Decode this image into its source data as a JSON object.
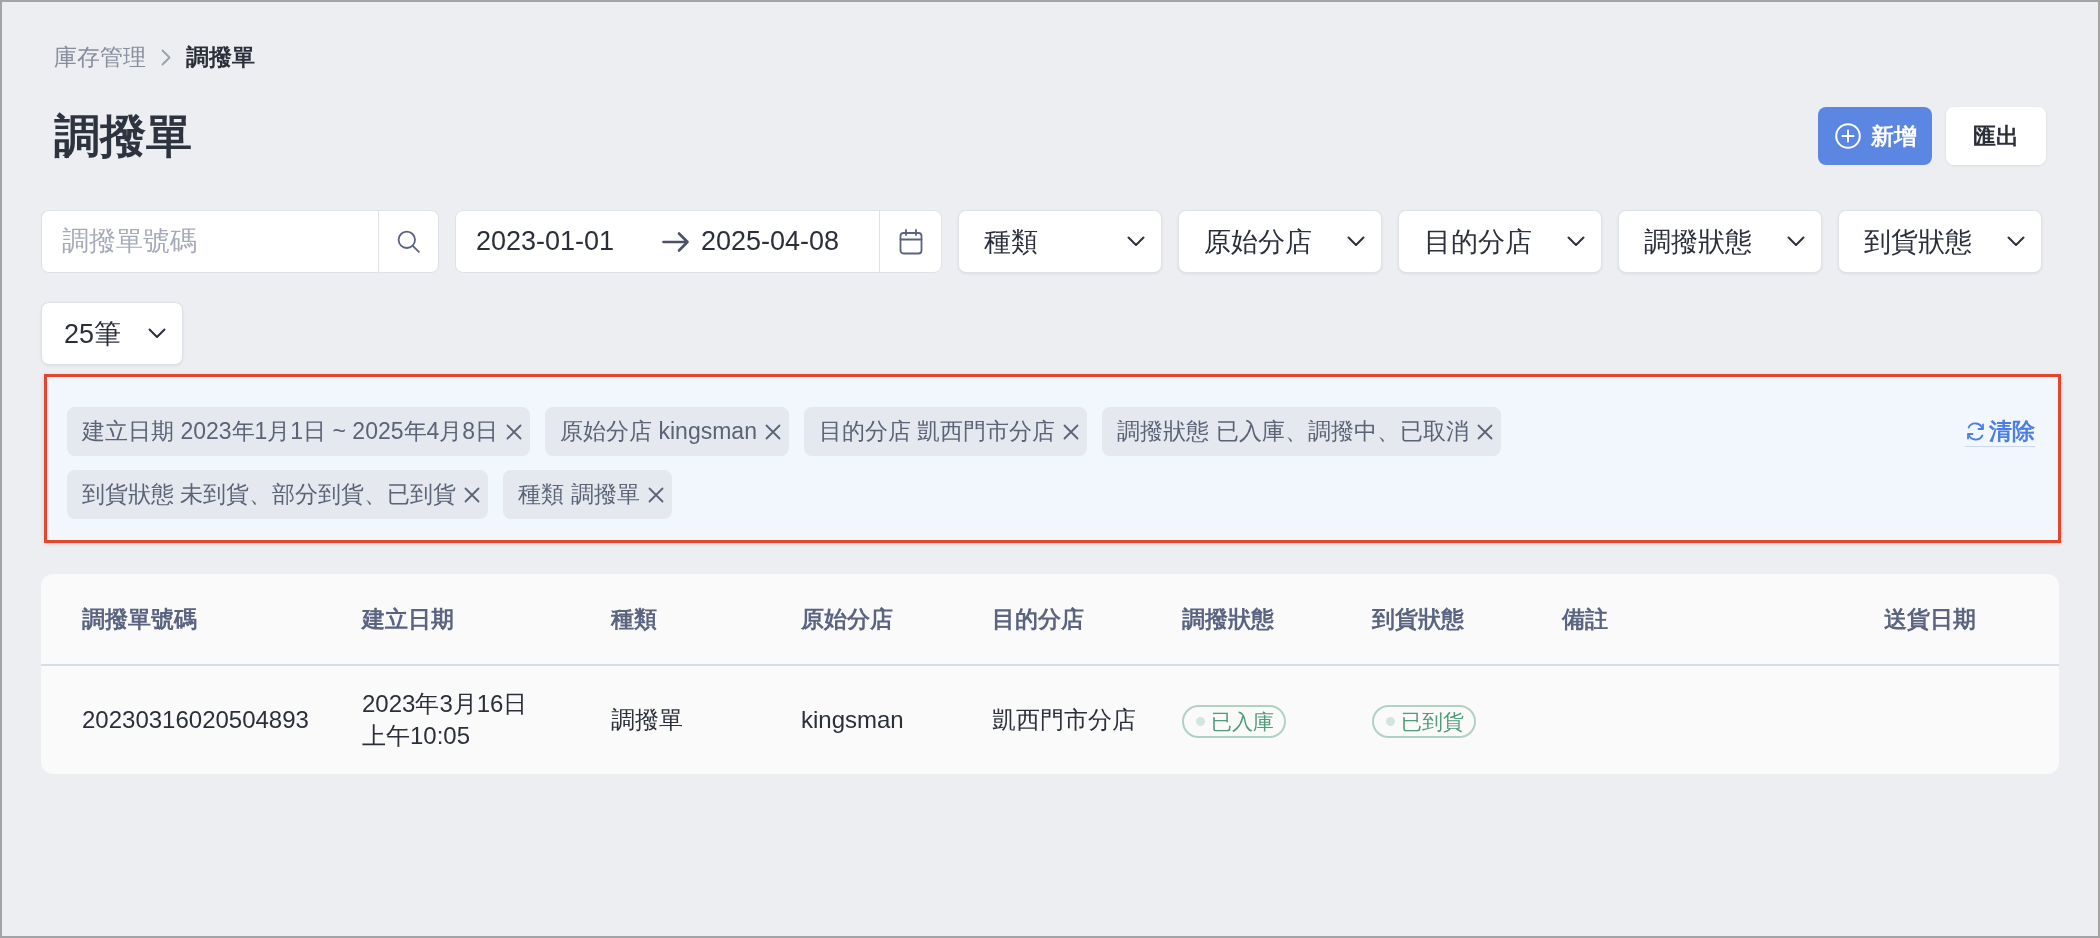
{
  "breadcrumb": [
    {
      "label": "庫存管理",
      "current": false
    },
    {
      "label": "調撥單",
      "current": true
    }
  ],
  "title": "調撥單",
  "actions": [
    {
      "kind": "primary",
      "label": "新增"
    },
    {
      "kind": "secondary",
      "label": "匯出"
    }
  ],
  "filters": {
    "search": {
      "placeholder": "調撥單號碼"
    },
    "date_range": {
      "start": "2023-01-01",
      "end": "2025-04-08"
    },
    "dropdowns": [
      {
        "label": "種類"
      },
      {
        "label": "原始分店"
      },
      {
        "label": "目的分店"
      },
      {
        "label": "調撥狀態"
      },
      {
        "label": "到貨狀態"
      }
    ],
    "page_size": {
      "label": "25筆"
    }
  },
  "active_filters": {
    "chips": [
      {
        "label": "建立日期 2023年1月1日 ~ 2025年4月8日"
      },
      {
        "label": "原始分店 kingsman"
      },
      {
        "label": "目的分店 凱西門市分店"
      },
      {
        "label": "調撥狀態 已入庫、調撥中、已取消"
      },
      {
        "label": "到貨狀態 未到貨、部分到貨、已到貨"
      },
      {
        "label": "種類 調撥單"
      }
    ],
    "clear": {
      "label": "清除"
    }
  },
  "table": {
    "columns": [
      "調撥單號碼",
      "建立日期",
      "種類",
      "原始分店",
      "目的分店",
      "調撥狀態",
      "到貨狀態",
      "備註",
      "送貨日期"
    ],
    "rows": [
      {
        "cells": [
          {
            "kind": "text",
            "text": "20230316020504893"
          },
          {
            "kind": "datetime",
            "date": "2023年3月16日",
            "time": "上午10:05"
          },
          {
            "kind": "text",
            "text": "調撥單"
          },
          {
            "kind": "text",
            "text": "kingsman"
          },
          {
            "kind": "text",
            "text": "凱西門市分店"
          },
          {
            "kind": "status",
            "label": "已入庫",
            "color": "#4f9b7a"
          },
          {
            "kind": "status",
            "label": "已到貨",
            "color": "#4f9b7a"
          }
        ]
      }
    ]
  }
}
